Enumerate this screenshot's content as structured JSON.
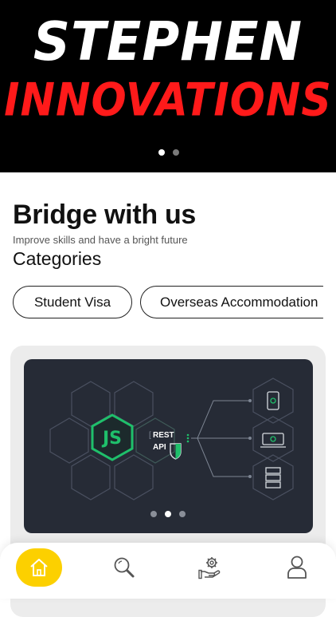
{
  "hero": {
    "line1": "STEPHEN",
    "line2": "INNOVATIONS",
    "slides": 2,
    "active_slide": 1
  },
  "main": {
    "heading": "Bridge with us",
    "subtitle": "Improve skills and have a bright future",
    "categories_title": "Categories",
    "categories": [
      "Student Visa",
      "Overseas Accommodation"
    ]
  },
  "feature_banner": {
    "logo_text": "JS",
    "api_text_line1": "REST",
    "api_text_line2": "API",
    "slides": 3,
    "active_slide": 2
  },
  "bottom_nav": {
    "items": [
      "home-icon",
      "search-icon",
      "settings-hand-icon",
      "profile-icon"
    ],
    "active": "home-icon"
  },
  "colors": {
    "accent": "#fcd000",
    "hero_bg": "#000000",
    "hero_red": "#ff1a1a",
    "banner_bg": "#262b36",
    "node_green": "#1fc06b"
  }
}
